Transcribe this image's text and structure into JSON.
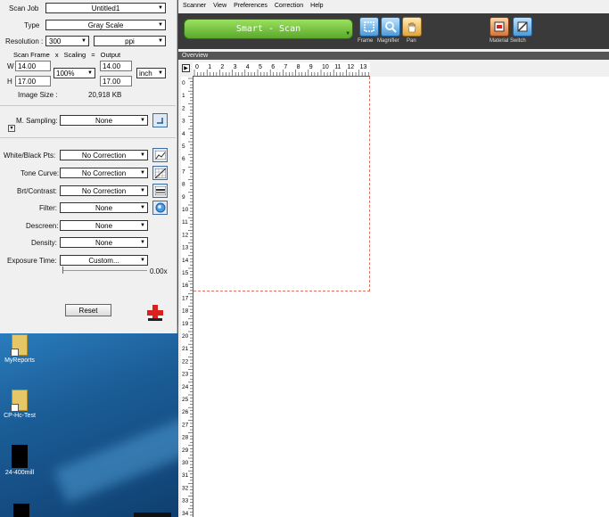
{
  "left_panel": {
    "scan_job": {
      "label": "Scan Job",
      "value": "Untitled1"
    },
    "type": {
      "label": "Type",
      "value": "Gray Scale"
    },
    "resolution": {
      "label": "Resolution :",
      "value": "300",
      "unit": "ppi"
    },
    "frame_header": {
      "scan_frame": "Scan Frame",
      "x": "x",
      "scaling": "Scaling",
      "eq": "=",
      "output": "Output"
    },
    "width": {
      "label": "W",
      "scan": "14.00",
      "scaling": "100%",
      "output": "14.00",
      "unit": "inch"
    },
    "height": {
      "label": "H",
      "scan": "17.00",
      "output": "17.00"
    },
    "image_size": {
      "label": "Image Size :",
      "value": "20,918 KB"
    },
    "m_sampling": {
      "label": "M. Sampling:",
      "value": "None"
    },
    "corrections": [
      {
        "label": "White/Black Pts:",
        "value": "No Correction"
      },
      {
        "label": "Tone Curve:",
        "value": "No Correction"
      },
      {
        "label": "Brt/Contrast:",
        "value": "No Correction"
      },
      {
        "label": "Filter:",
        "value": "None"
      },
      {
        "label": "Descreen:",
        "value": "None"
      },
      {
        "label": "Density:",
        "value": "None"
      },
      {
        "label": "Exposure Time:",
        "value": "Custom..."
      }
    ],
    "exposure_value": "0.00x",
    "reset_label": "Reset"
  },
  "menu": [
    "Scanner",
    "View",
    "Preferences",
    "Correction",
    "Help"
  ],
  "toolbar": {
    "scan_label": "Smart - Scan",
    "tools": [
      {
        "label": "Frame",
        "icon": "frame-icon"
      },
      {
        "label": "Magnifier",
        "icon": "magnifier-icon"
      },
      {
        "label": "Pan",
        "icon": "pan-hand-icon"
      },
      {
        "label": "Material Switch",
        "icon": "material-switch-icon"
      }
    ]
  },
  "overview": {
    "label": "Overview"
  },
  "ruler": {
    "h_ticks": [
      "0",
      "1",
      "2",
      "3",
      "4",
      "5",
      "6",
      "7",
      "8",
      "9",
      "10",
      "11",
      "12",
      "13"
    ],
    "v_ticks": [
      "0",
      "1",
      "2",
      "3",
      "4",
      "5",
      "6",
      "7",
      "8",
      "9",
      "10",
      "11",
      "12",
      "13",
      "14",
      "15",
      "16",
      "17",
      "18",
      "19",
      "20",
      "21",
      "22",
      "23",
      "24",
      "25",
      "26",
      "27",
      "28",
      "29",
      "30",
      "31",
      "32",
      "33",
      "34"
    ]
  },
  "desktop": {
    "icons": [
      {
        "label": "MyReports",
        "icon": "folder-icon"
      },
      {
        "label": "CP-Hc-Test",
        "icon": "folder-icon"
      },
      {
        "label": "24-400mill",
        "icon": "document-icon"
      }
    ]
  }
}
